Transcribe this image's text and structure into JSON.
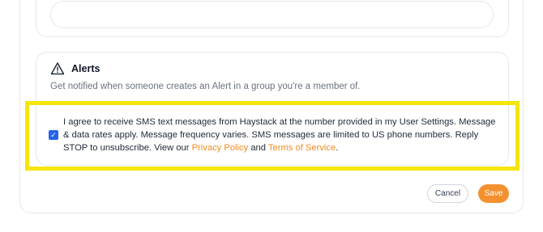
{
  "top_section": {
    "input_value": ""
  },
  "alerts": {
    "title": "Alerts",
    "description": "Get notified when someone creates an Alert in a group you're a member of.",
    "icon": "warning-triangle-icon",
    "consent": {
      "checked": true,
      "text_before": "I agree to receive SMS text messages from Haystack at the number provided in my User Settings. Message & data rates apply. Message frequency varies. SMS messages are limited to US phone numbers. Reply STOP to unsubscribe. View our ",
      "privacy_link": "Privacy Policy",
      "and_text": " and ",
      "terms_link": "Terms of Service",
      "end_text": "."
    }
  },
  "actions": {
    "cancel_label": "Cancel",
    "save_label": "Save"
  },
  "colors": {
    "accent": "#f59030",
    "link": "#f28a1e",
    "highlight": "#f5e50a",
    "checkbox": "#2563eb"
  }
}
